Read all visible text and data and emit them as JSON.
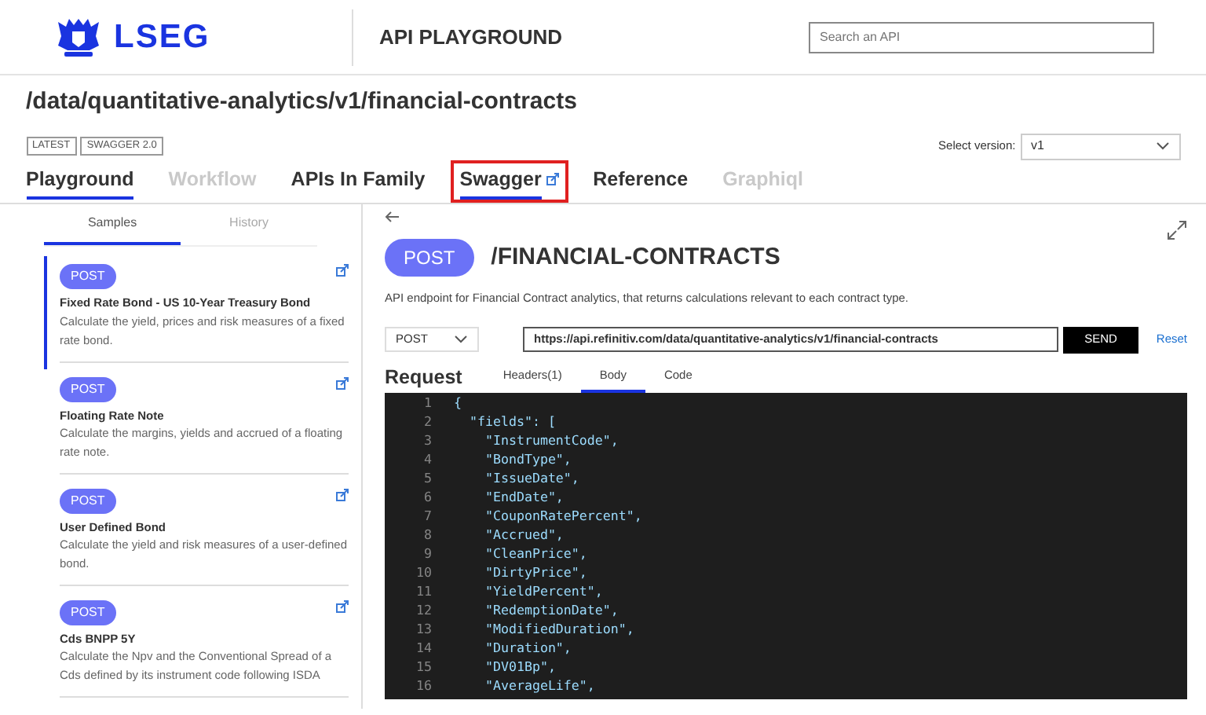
{
  "header": {
    "logo_text": "LSEG",
    "app_title": "API PLAYGROUND",
    "search": {
      "placeholder": "Search an API"
    }
  },
  "page": {
    "title": "/data/quantitative-analytics/v1/financial-contracts",
    "badges": [
      "LATEST",
      "SWAGGER 2.0"
    ],
    "version_label": "Select version:",
    "version_value": "v1",
    "tabs": [
      {
        "label": "Playground",
        "selected": true,
        "disabled": false,
        "external": false,
        "highlighted": false
      },
      {
        "label": "Workflow",
        "selected": false,
        "disabled": true,
        "external": false,
        "highlighted": false
      },
      {
        "label": "APIs In Family",
        "selected": false,
        "disabled": false,
        "external": false,
        "highlighted": false
      },
      {
        "label": "Swagger",
        "selected": true,
        "disabled": false,
        "external": true,
        "highlighted": true
      },
      {
        "label": "Reference",
        "selected": false,
        "disabled": false,
        "external": false,
        "highlighted": false
      },
      {
        "label": "Graphiql",
        "selected": false,
        "disabled": true,
        "external": false,
        "highlighted": false
      }
    ]
  },
  "sidebar": {
    "tabs": [
      {
        "label": "Samples",
        "selected": true
      },
      {
        "label": "History",
        "selected": false
      }
    ],
    "samples": [
      {
        "method": "POST",
        "title": "Fixed Rate Bond - US 10-Year Treasury Bond",
        "description": "Calculate the yield, prices and risk measures of a fixed rate bond.",
        "selected": true
      },
      {
        "method": "POST",
        "title": "Floating Rate Note",
        "description": "Calculate the margins, yields and accrued of a floating rate note.",
        "selected": false
      },
      {
        "method": "POST",
        "title": "User Defined Bond",
        "description": "Calculate the yield and risk measures of a user-defined bond.",
        "selected": false
      },
      {
        "method": "POST",
        "title": "Cds BNPP 5Y",
        "description": "Calculate the Npv and the Conventional Spread of a Cds defined by its instrument code following ISDA",
        "selected": false
      }
    ]
  },
  "detail": {
    "method": "POST",
    "endpoint": "/FINANCIAL-CONTRACTS",
    "description": "API endpoint for Financial Contract analytics, that returns calculations relevant to each contract type.",
    "request_method": "POST",
    "url": "https://api.refinitiv.com/data/quantitative-analytics/v1/financial-contracts",
    "send": "SEND",
    "reset": "Reset",
    "request_heading": "Request",
    "request_tabs": [
      {
        "label": "Headers(1)",
        "selected": false
      },
      {
        "label": "Body",
        "selected": true
      },
      {
        "label": "Code",
        "selected": false
      }
    ],
    "code_lines": [
      {
        "number": "1",
        "text": "{"
      },
      {
        "number": "2",
        "text": "  \"fields\": ["
      },
      {
        "number": "3",
        "text": "    \"InstrumentCode\","
      },
      {
        "number": "4",
        "text": "    \"BondType\","
      },
      {
        "number": "5",
        "text": "    \"IssueDate\","
      },
      {
        "number": "6",
        "text": "    \"EndDate\","
      },
      {
        "number": "7",
        "text": "    \"CouponRatePercent\","
      },
      {
        "number": "8",
        "text": "    \"Accrued\","
      },
      {
        "number": "9",
        "text": "    \"CleanPrice\","
      },
      {
        "number": "10",
        "text": "    \"DirtyPrice\","
      },
      {
        "number": "11",
        "text": "    \"YieldPercent\","
      },
      {
        "number": "12",
        "text": "    \"RedemptionDate\","
      },
      {
        "number": "13",
        "text": "    \"ModifiedDuration\","
      },
      {
        "number": "14",
        "text": "    \"Duration\","
      },
      {
        "number": "15",
        "text": "    \"DV01Bp\","
      },
      {
        "number": "16",
        "text": "    \"AverageLife\","
      }
    ]
  }
}
